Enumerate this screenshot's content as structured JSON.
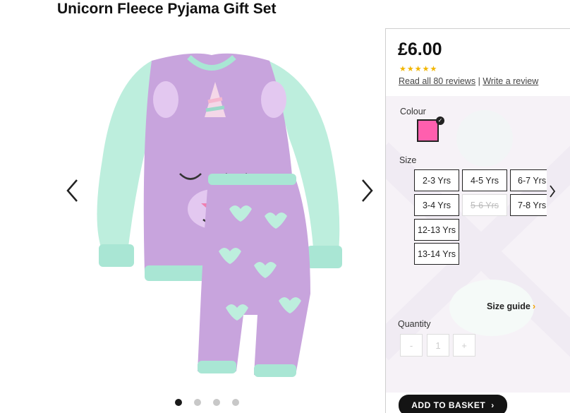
{
  "product": {
    "title": "Unicorn Fleece Pyjama Gift Set",
    "price": "£6.00",
    "rating": 5,
    "reviews_link": "Read all 80 reviews",
    "separator": "|",
    "write_review_link": "Write a review"
  },
  "gallery": {
    "dots": 4,
    "active_dot": 1,
    "image_icon": "unicorn-pyjama-image"
  },
  "colour": {
    "label": "Colour",
    "selected": "#ff5fae",
    "check": "✓"
  },
  "size": {
    "label": "Size",
    "options": [
      {
        "label": "2-3 Yrs"
      },
      {
        "label": "4-5 Yrs"
      },
      {
        "label": "6-7 Yrs"
      },
      {
        "label": "3-4 Yrs"
      },
      {
        "label": "5-6 Yrs",
        "disabled": true
      },
      {
        "label": "7-8 Yrs"
      },
      {
        "label": "12-13 Yrs"
      },
      {
        "label": "13-14 Yrs"
      }
    ],
    "guide": "Size guide",
    "guide_chevron": "›"
  },
  "quantity": {
    "label": "Quantity",
    "minus": "-",
    "value": "1",
    "plus": "+"
  },
  "basket": {
    "label": "ADD TO BASKET",
    "chevron": "›"
  },
  "colors": {
    "star": "#f2b600",
    "accent": "#f2a100",
    "button": "#141414"
  }
}
